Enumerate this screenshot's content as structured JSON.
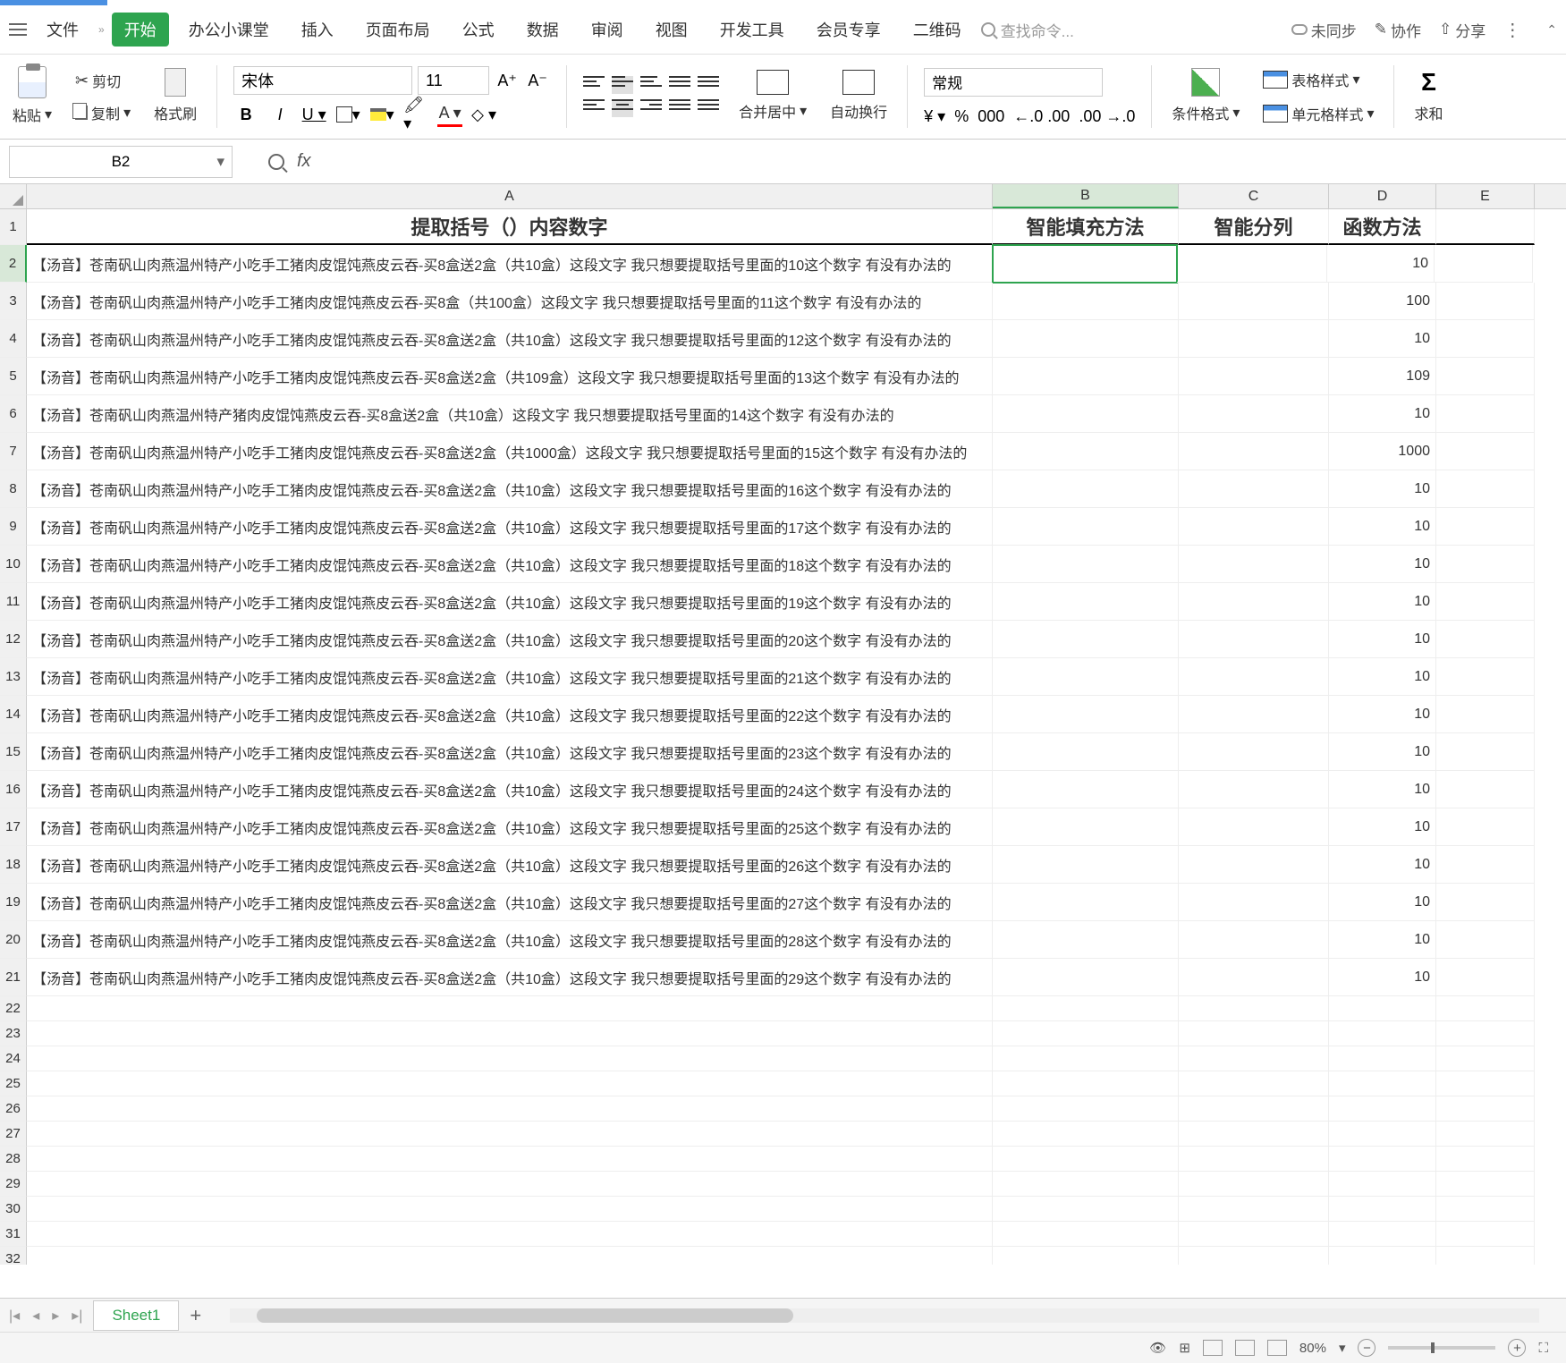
{
  "menubar": {
    "file": "文件",
    "items": [
      "开始",
      "办公小课堂",
      "插入",
      "页面布局",
      "公式",
      "数据",
      "审阅",
      "视图",
      "开发工具",
      "会员专享",
      "二维码"
    ],
    "search_placeholder": "查找命令...",
    "unsync": "未同步",
    "collab": "协作",
    "share": "分享"
  },
  "ribbon": {
    "paste": "粘贴",
    "cut": "剪切",
    "copy": "复制",
    "format_painter": "格式刷",
    "font_name": "宋体",
    "font_size": "11",
    "merge": "合并居中",
    "wrap": "自动换行",
    "num_format": "常规",
    "cond_fmt": "条件格式",
    "table_style": "表格样式",
    "cell_style": "单元格样式",
    "sum": "求和"
  },
  "formula_bar": {
    "cell_ref": "B2",
    "formula": ""
  },
  "columns": [
    "A",
    "B",
    "C",
    "D",
    "E"
  ],
  "headers": {
    "A": "提取括号（）内容数字",
    "B": "智能填充方法",
    "C": "智能分列",
    "D": "函数方法"
  },
  "rows": [
    {
      "n": 2,
      "A": "【汤音】苍南矾山肉燕温州特产小吃手工猪肉皮馄饨燕皮云吞-买8盒送2盒（共10盒）这段文字  我只想要提取括号里面的10这个数字  有没有办法的",
      "D": "10"
    },
    {
      "n": 3,
      "A": "【汤音】苍南矾山肉燕温州特产小吃手工猪肉皮馄饨燕皮云吞-买8盒（共100盒）这段文字  我只想要提取括号里面的11这个数字  有没有办法的",
      "D": "100"
    },
    {
      "n": 4,
      "A": "【汤音】苍南矾山肉燕温州特产小吃手工猪肉皮馄饨燕皮云吞-买8盒送2盒（共10盒）这段文字  我只想要提取括号里面的12这个数字  有没有办法的",
      "D": "10"
    },
    {
      "n": 5,
      "A": "【汤音】苍南矾山肉燕温州特产小吃手工猪肉皮馄饨燕皮云吞-买8盒送2盒（共109盒）这段文字  我只想要提取括号里面的13这个数字  有没有办法的",
      "D": "109"
    },
    {
      "n": 6,
      "A": "【汤音】苍南矾山肉燕温州特产猪肉皮馄饨燕皮云吞-买8盒送2盒（共10盒）这段文字  我只想要提取括号里面的14这个数字  有没有办法的",
      "D": "10"
    },
    {
      "n": 7,
      "A": "【汤音】苍南矾山肉燕温州特产小吃手工猪肉皮馄饨燕皮云吞-买8盒送2盒（共1000盒）这段文字  我只想要提取括号里面的15这个数字  有没有办法的",
      "D": "1000"
    },
    {
      "n": 8,
      "A": "【汤音】苍南矾山肉燕温州特产小吃手工猪肉皮馄饨燕皮云吞-买8盒送2盒（共10盒）这段文字  我只想要提取括号里面的16这个数字  有没有办法的",
      "D": "10"
    },
    {
      "n": 9,
      "A": "【汤音】苍南矾山肉燕温州特产小吃手工猪肉皮馄饨燕皮云吞-买8盒送2盒（共10盒）这段文字  我只想要提取括号里面的17这个数字  有没有办法的",
      "D": "10"
    },
    {
      "n": 10,
      "A": "【汤音】苍南矾山肉燕温州特产小吃手工猪肉皮馄饨燕皮云吞-买8盒送2盒（共10盒）这段文字  我只想要提取括号里面的18这个数字  有没有办法的",
      "D": "10"
    },
    {
      "n": 11,
      "A": "【汤音】苍南矾山肉燕温州特产小吃手工猪肉皮馄饨燕皮云吞-买8盒送2盒（共10盒）这段文字  我只想要提取括号里面的19这个数字  有没有办法的",
      "D": "10"
    },
    {
      "n": 12,
      "A": "【汤音】苍南矾山肉燕温州特产小吃手工猪肉皮馄饨燕皮云吞-买8盒送2盒（共10盒）这段文字  我只想要提取括号里面的20这个数字  有没有办法的",
      "D": "10"
    },
    {
      "n": 13,
      "A": "【汤音】苍南矾山肉燕温州特产小吃手工猪肉皮馄饨燕皮云吞-买8盒送2盒（共10盒）这段文字  我只想要提取括号里面的21这个数字  有没有办法的",
      "D": "10"
    },
    {
      "n": 14,
      "A": "【汤音】苍南矾山肉燕温州特产小吃手工猪肉皮馄饨燕皮云吞-买8盒送2盒（共10盒）这段文字  我只想要提取括号里面的22这个数字  有没有办法的",
      "D": "10"
    },
    {
      "n": 15,
      "A": "【汤音】苍南矾山肉燕温州特产小吃手工猪肉皮馄饨燕皮云吞-买8盒送2盒（共10盒）这段文字  我只想要提取括号里面的23这个数字  有没有办法的",
      "D": "10"
    },
    {
      "n": 16,
      "A": "【汤音】苍南矾山肉燕温州特产小吃手工猪肉皮馄饨燕皮云吞-买8盒送2盒（共10盒）这段文字  我只想要提取括号里面的24这个数字  有没有办法的",
      "D": "10"
    },
    {
      "n": 17,
      "A": "【汤音】苍南矾山肉燕温州特产小吃手工猪肉皮馄饨燕皮云吞-买8盒送2盒（共10盒）这段文字  我只想要提取括号里面的25这个数字  有没有办法的",
      "D": "10"
    },
    {
      "n": 18,
      "A": "【汤音】苍南矾山肉燕温州特产小吃手工猪肉皮馄饨燕皮云吞-买8盒送2盒（共10盒）这段文字  我只想要提取括号里面的26这个数字  有没有办法的",
      "D": "10"
    },
    {
      "n": 19,
      "A": "【汤音】苍南矾山肉燕温州特产小吃手工猪肉皮馄饨燕皮云吞-买8盒送2盒（共10盒）这段文字  我只想要提取括号里面的27这个数字  有没有办法的",
      "D": "10"
    },
    {
      "n": 20,
      "A": "【汤音】苍南矾山肉燕温州特产小吃手工猪肉皮馄饨燕皮云吞-买8盒送2盒（共10盒）这段文字  我只想要提取括号里面的28这个数字  有没有办法的",
      "D": "10"
    },
    {
      "n": 21,
      "A": "【汤音】苍南矾山肉燕温州特产小吃手工猪肉皮馄饨燕皮云吞-买8盒送2盒（共10盒）这段文字  我只想要提取括号里面的29这个数字  有没有办法的",
      "D": "10"
    }
  ],
  "empty_rows": [
    22,
    23,
    24,
    25,
    26,
    27,
    28,
    29,
    30,
    31,
    32
  ],
  "sheet": {
    "name": "Sheet1"
  },
  "status": {
    "zoom": "80%"
  }
}
